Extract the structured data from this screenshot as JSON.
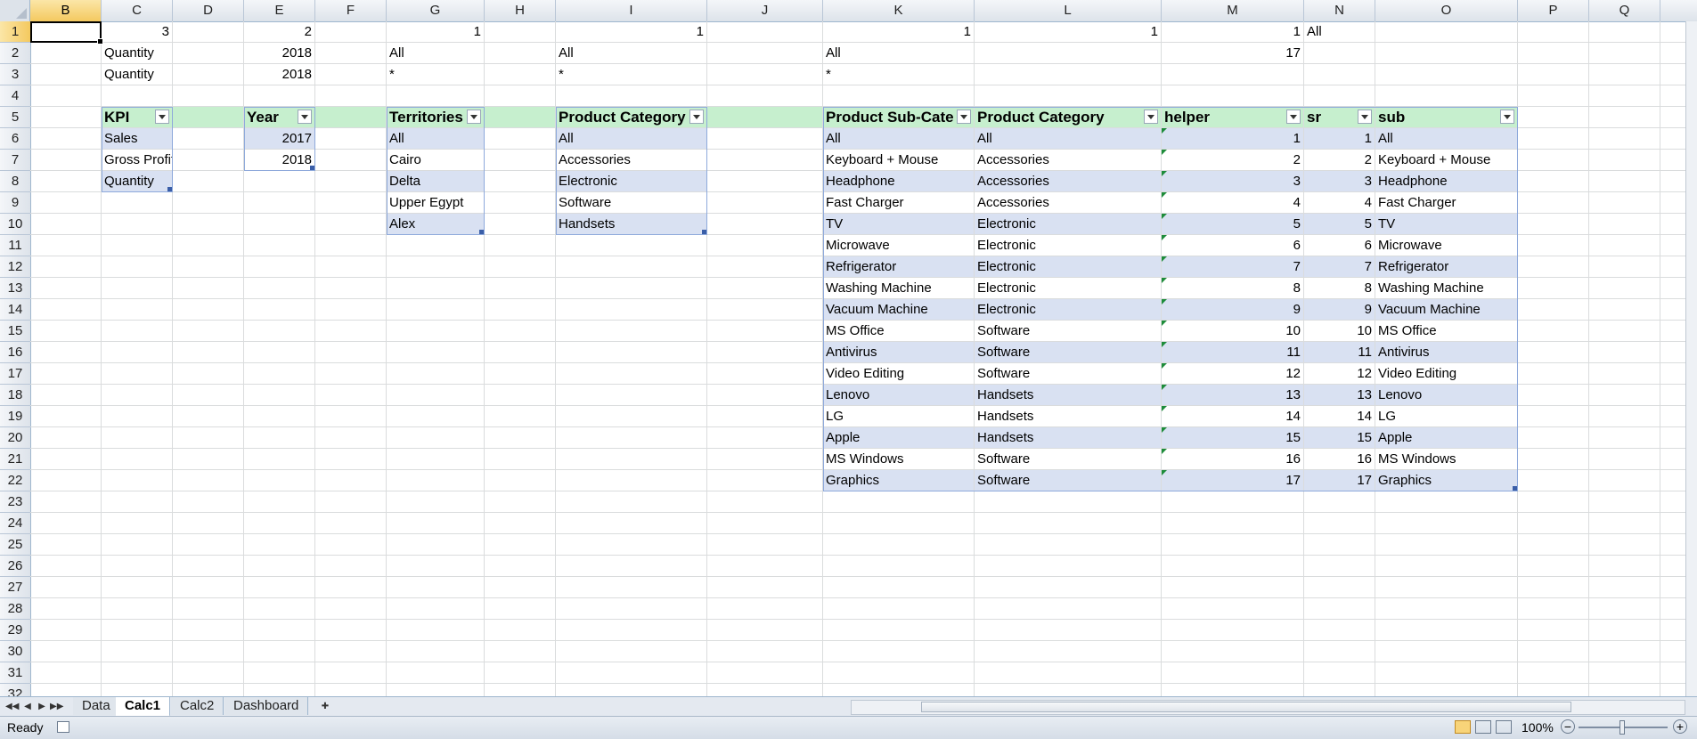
{
  "columns": [
    "B",
    "C",
    "D",
    "E",
    "F",
    "G",
    "H",
    "I",
    "J",
    "K",
    "L",
    "M",
    "N",
    "O",
    "P",
    "Q"
  ],
  "rows": [
    "1",
    "2",
    "3",
    "4",
    "5",
    "6",
    "7",
    "8",
    "9",
    "10",
    "11",
    "12",
    "13",
    "14",
    "15",
    "16",
    "17",
    "18",
    "19",
    "20",
    "21",
    "22",
    "23",
    "24",
    "25",
    "26",
    "27",
    "28",
    "29",
    "30",
    "31",
    "32"
  ],
  "cells": {
    "c1": "3",
    "e1": "2",
    "g1": "1",
    "i1": "1",
    "k1": "1",
    "l1": "1",
    "m1": "1",
    "n1": "All",
    "c2": "Quantity",
    "e2": "2018",
    "g2": "All",
    "i2": "All",
    "k2": "All",
    "m2": "17",
    "c3": "Quantity",
    "e3": "2018",
    "g3": "*",
    "i3": "*",
    "k3": "*"
  },
  "kpi_table": {
    "header": "KPI",
    "items": [
      "Sales",
      "Gross Profit",
      "Quantity"
    ]
  },
  "year_table": {
    "header": "Year",
    "items": [
      "2017",
      "2018"
    ]
  },
  "territories_table": {
    "header": "Territories",
    "items": [
      "All",
      "Cairo",
      "Delta",
      "Upper Egypt",
      "Alex"
    ]
  },
  "category_table": {
    "header": "Product Category",
    "items": [
      "All",
      "Accessories",
      "Electronic",
      "Software",
      "Handsets"
    ]
  },
  "sub_table": {
    "headers": [
      "Product Sub-Cate",
      "Product Category",
      "helper",
      "sr",
      "sub"
    ],
    "rows": [
      [
        "All",
        "All",
        "1",
        "1",
        "All"
      ],
      [
        "Keyboard + Mouse",
        "Accessories",
        "2",
        "2",
        "Keyboard + Mouse"
      ],
      [
        "Headphone",
        "Accessories",
        "3",
        "3",
        "Headphone"
      ],
      [
        "Fast Charger",
        "Accessories",
        "4",
        "4",
        "Fast Charger"
      ],
      [
        "TV",
        "Electronic",
        "5",
        "5",
        "TV"
      ],
      [
        "Microwave",
        "Electronic",
        "6",
        "6",
        "Microwave"
      ],
      [
        "Refrigerator",
        "Electronic",
        "7",
        "7",
        "Refrigerator"
      ],
      [
        "Washing Machine",
        "Electronic",
        "8",
        "8",
        "Washing Machine"
      ],
      [
        "Vacuum Machine",
        "Electronic",
        "9",
        "9",
        "Vacuum Machine"
      ],
      [
        "MS Office",
        "Software",
        "10",
        "10",
        "MS Office"
      ],
      [
        "Antivirus",
        "Software",
        "11",
        "11",
        "Antivirus"
      ],
      [
        "Video Editing",
        "Software",
        "12",
        "12",
        "Video Editing"
      ],
      [
        "Lenovo",
        "Handsets",
        "13",
        "13",
        "Lenovo"
      ],
      [
        "LG",
        "Handsets",
        "14",
        "14",
        "LG"
      ],
      [
        "Apple",
        "Handsets",
        "15",
        "15",
        "Apple"
      ],
      [
        "MS Windows",
        "Software",
        "16",
        "16",
        "MS Windows"
      ],
      [
        "Graphics",
        "Software",
        "17",
        "17",
        "Graphics"
      ]
    ]
  },
  "sheet_tabs": [
    "Data",
    "Calc1",
    "Calc2",
    "Dashboard"
  ],
  "active_tab": "Calc1",
  "status": {
    "text": "Ready",
    "zoom": "100%"
  },
  "colors": {
    "header_green": "#c6efce",
    "band_blue": "#d9e1f2",
    "selection": "#f4c95f"
  }
}
